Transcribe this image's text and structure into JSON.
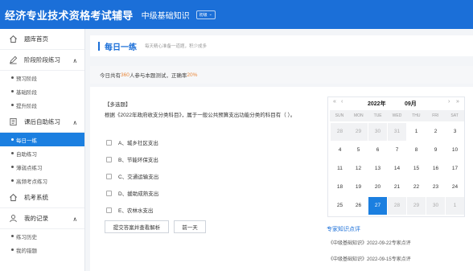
{
  "header": {
    "app_title": "经济专业技术资格考试辅导",
    "course": "中级基础知识",
    "level": "初级",
    "level_arrow": "⌄"
  },
  "sidebar": {
    "groups": [
      {
        "label": "题库首页",
        "icon": "home-icon",
        "arrow": ""
      },
      {
        "label": "阶段阶段练习",
        "icon": "pen-icon",
        "arrow": "∧",
        "items": [
          "预习阶段",
          "基础阶段",
          "提升阶段"
        ]
      },
      {
        "label": "课后自助练习",
        "icon": "book-icon",
        "arrow": "∧",
        "items": [
          "每日一练",
          "自助练习",
          "薄弱点练习",
          "高频考点练习"
        ]
      },
      {
        "label": "机考系统",
        "icon": "home-icon",
        "arrow": ""
      },
      {
        "label": "我的记录",
        "icon": "user-icon",
        "arrow": "∧",
        "items": [
          "练习历史",
          "我的错题"
        ]
      }
    ],
    "active_item": "每日一练"
  },
  "main": {
    "title": "每日一练",
    "subtitle": "每天精心准备一道题，积少成多",
    "stats_prefix": "今日共有",
    "stats_count": "360",
    "stats_mid": "人参与本题测试，正确率",
    "stats_rate": "20%"
  },
  "question": {
    "type": "【多选题】",
    "text": "根据《2022年政府收支分类科目》，属于一般公共预算支出功能分类的科目有（ ）。",
    "options": [
      "A、城乡社区支出",
      "B、节能环保支出",
      "C、交通运输支出",
      "D、援助成熟支出",
      "E、农林水支出"
    ],
    "submit_label": "提交答案并查看解析",
    "prev_label": "前一天"
  },
  "calendar": {
    "year": "2022年",
    "month": "09月",
    "prev_year": "«",
    "prev_month": "‹",
    "next_month": "›",
    "next_year": "»",
    "weekdays": [
      "SUN",
      "MON",
      "TUE",
      "WED",
      "THU",
      "FRI",
      "SAT"
    ],
    "days": [
      {
        "d": "28",
        "o": true
      },
      {
        "d": "29",
        "o": true
      },
      {
        "d": "30",
        "o": true
      },
      {
        "d": "31",
        "o": true
      },
      {
        "d": "1"
      },
      {
        "d": "2"
      },
      {
        "d": "3"
      },
      {
        "d": "4"
      },
      {
        "d": "5"
      },
      {
        "d": "6"
      },
      {
        "d": "7"
      },
      {
        "d": "8"
      },
      {
        "d": "9"
      },
      {
        "d": "10"
      },
      {
        "d": "11"
      },
      {
        "d": "12"
      },
      {
        "d": "13"
      },
      {
        "d": "14"
      },
      {
        "d": "15"
      },
      {
        "d": "16"
      },
      {
        "d": "17"
      },
      {
        "d": "18"
      },
      {
        "d": "19"
      },
      {
        "d": "20"
      },
      {
        "d": "21"
      },
      {
        "d": "22"
      },
      {
        "d": "23"
      },
      {
        "d": "24"
      },
      {
        "d": "25"
      },
      {
        "d": "26"
      },
      {
        "d": "27",
        "t": true
      },
      {
        "d": "28",
        "o": true
      },
      {
        "d": "29",
        "o": true
      },
      {
        "d": "30",
        "o": true
      },
      {
        "d": "1",
        "o": true
      }
    ]
  },
  "recommend": {
    "title": "专家知识点评",
    "items": [
      "《中级基础知识》2022-09-22专家点评",
      "《中级基础知识》2022-09-15专家点评"
    ]
  },
  "colors": {
    "brand": "#1b6fd8",
    "accent": "#e9883b",
    "active": "#1b7fe0"
  }
}
